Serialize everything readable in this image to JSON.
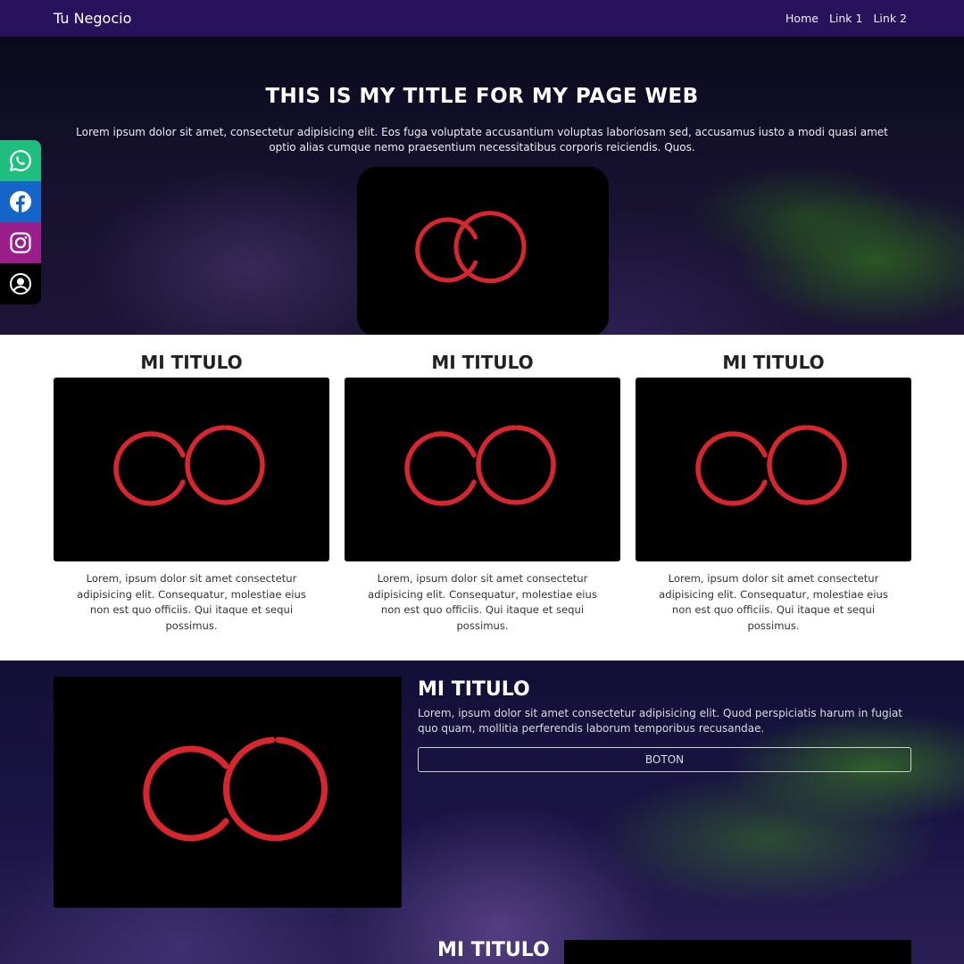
{
  "navbar": {
    "brand": "Tu Negocio",
    "links": [
      "Home",
      "Link 1",
      "Link 2"
    ]
  },
  "hero": {
    "title": "THIS IS MY TITLE FOR MY PAGE WEB",
    "text": "Lorem ipsum dolor sit amet, consectetur adipisicing elit. Eos fuga voluptate accusantium voluptas laboriosam sed, accusamus iusto a modi quasi amet optio alias cumque nemo praesentium necessitatibus corporis reiciendis. Quos."
  },
  "social": {
    "icons": [
      "whatsapp-icon",
      "facebook-icon",
      "instagram-icon",
      "account-icon"
    ],
    "colors": {
      "whatsapp": "#1ebe7e",
      "facebook": "#1565c8",
      "instagram": "#9a1e8a",
      "account": "#000000"
    }
  },
  "cards": [
    {
      "title": "MI TITULO",
      "text": "Lorem, ipsum dolor sit amet consectetur adipisicing elit. Consequatur, molestiae eius non est quo officiis. Qui itaque et sequi possimus."
    },
    {
      "title": "MI TITULO",
      "text": "Lorem, ipsum dolor sit amet consectetur adipisicing elit. Consequatur, molestiae eius non est quo officiis. Qui itaque et sequi possimus."
    },
    {
      "title": "MI TITULO",
      "text": "Lorem, ipsum dolor sit amet consectetur adipisicing elit. Consequatur, molestiae eius non est quo officiis. Qui itaque et sequi possimus."
    }
  ],
  "feature": {
    "title": "MI TITULO",
    "text": "Lorem, ipsum dolor sit amet consectetur adipisicing elit. Quod perspiciatis harum in fugiat quo quam, mollitia perferendis laborum temporibus recusandae.",
    "button_label": "BOTON"
  },
  "bottom": {
    "title": "MI TITULO"
  },
  "colors": {
    "navbar": "#26135c",
    "logo_red": "#d8262e"
  }
}
